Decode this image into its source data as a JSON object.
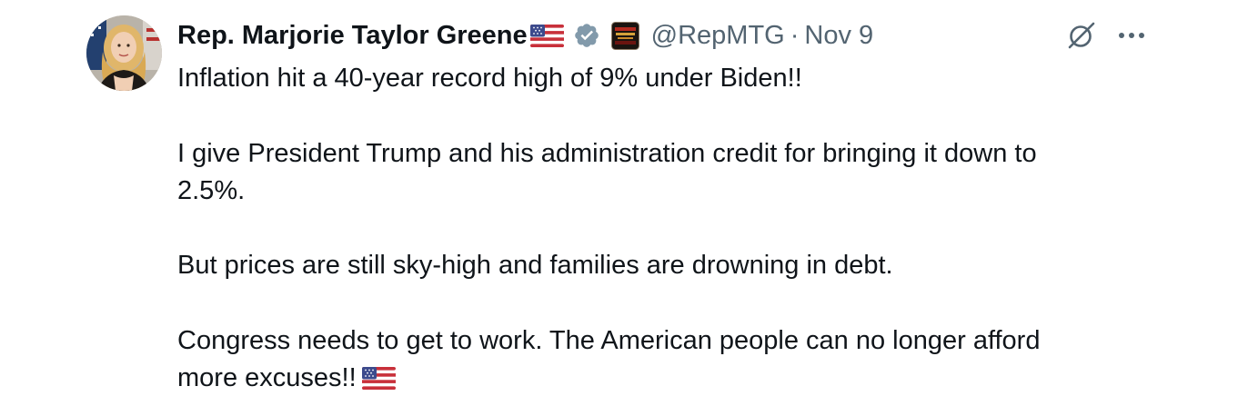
{
  "author": {
    "display_name": "Rep. Marjorie Taylor Greene",
    "handle": "@RepMTG",
    "separator": "·",
    "timestamp": "Nov 9",
    "name_emoji": "us-flag-emoji",
    "verified_icon": "verified-badge-icon",
    "affiliate_icon": "affiliate-badge-icon",
    "verified_color": "#829aab"
  },
  "actions": {
    "grok_icon": "grok-icon",
    "more_icon": "more-horizontal-icon"
  },
  "tweet": {
    "lines": [
      "Inflation hit a 40-year record high of 9% under Biden!!",
      "",
      "I give President Trump and his administration credit for bringing it down to",
      "2.5%.",
      "",
      "But prices are still sky-high and families are drowning in debt.",
      "",
      "Congress needs to get to work. The American people can no longer afford",
      "more excuses!!"
    ],
    "trailing_emoji": "us-flag-emoji"
  },
  "colors": {
    "text": "#0f1419",
    "secondary": "#536471",
    "background": "#ffffff"
  }
}
